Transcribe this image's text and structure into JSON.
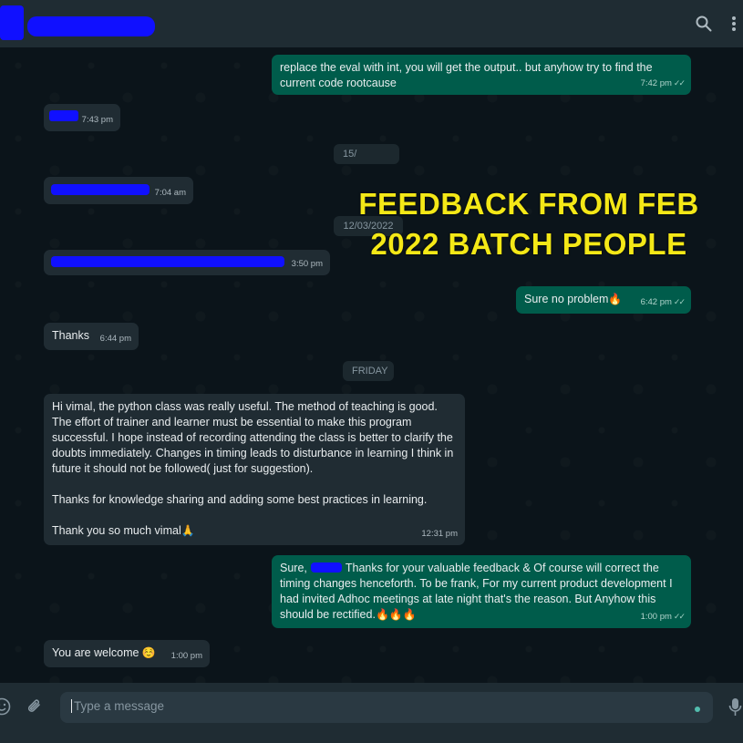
{
  "header": {
    "search_icon": "search-icon",
    "menu_icon": "kebab-menu-icon"
  },
  "overlay": {
    "line1": "FEEDBACK FROM FEB",
    "line2": "2022 BATCH PEOPLE",
    "color": "#f4e817"
  },
  "messages": [
    {
      "dir": "out",
      "text_lines": [
        "replace the eval with int, you will get the output.. but anyhow try to find the",
        "current code rootcause"
      ],
      "time": "7:42 pm"
    },
    {
      "dir": "in",
      "redacted": true,
      "time": "7:43 pm"
    },
    {
      "dir": "in",
      "redacted": true,
      "time": "7:04 am"
    },
    {
      "dir": "in",
      "redacted": true,
      "time": "3:50 pm"
    },
    {
      "dir": "out",
      "text": "Sure no problem",
      "emoji": "🔥",
      "time": "6:42 pm"
    },
    {
      "dir": "in",
      "text": "Thanks",
      "time": "6:44 pm"
    },
    {
      "dir": "in",
      "paragraphs": [
        "Hi vimal, the python class was really useful. The method of teaching is good. The effort of trainer and learner must be essential to make this program successful. I hope instead of recording attending the class is better to clarify the doubts immediately. Changes in timing leads to disturbance in learning  I think in future it should not be followed( just for suggestion).",
        "Thanks for knowledge sharing and adding some best practices in learning.",
        "Thank you so much vimal"
      ],
      "emoji": "🙏",
      "time": "12:31 pm"
    },
    {
      "dir": "out",
      "prefix": "Sure,",
      "text": "Thanks for your valuable feedback & Of course will correct the timing changes henceforth. To be frank, For my current product development I had invited Adhoc meetings at late night that's the reason. But Anyhow this should be rectified.",
      "emoji": "🔥🔥🔥",
      "time": "1:00 pm"
    },
    {
      "dir": "in",
      "text": "You are welcome",
      "emoji": "☺️",
      "time": "1:00 pm"
    }
  ],
  "date_pills": [
    "15/",
    "12/03/2022",
    "FRIDAY"
  ],
  "composer": {
    "placeholder": "Type a message",
    "emoji_icon": "emoji-icon",
    "attach_icon": "paperclip-icon",
    "mic_icon": "microphone-icon"
  },
  "colors": {
    "incoming": "#202c33",
    "outgoing": "#005c4b",
    "background": "#0b141a",
    "redaction": "#1010ff"
  }
}
